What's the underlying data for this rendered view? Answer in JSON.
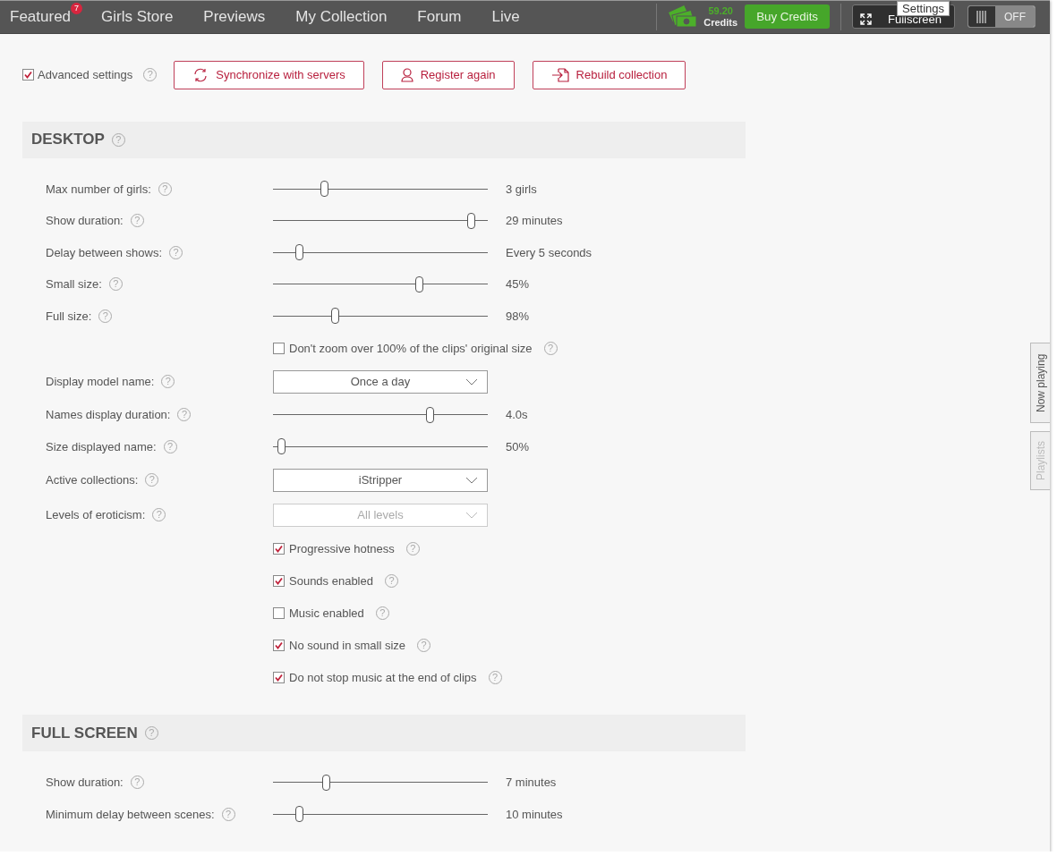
{
  "nav": {
    "items": [
      {
        "label": "Featured",
        "badge": "7",
        "selected": false
      },
      {
        "label": "Girls Store",
        "selected": false
      },
      {
        "label": "Previews",
        "selected": false
      },
      {
        "label": "My Collection",
        "selected": false
      },
      {
        "label": "Forum",
        "selected": false
      },
      {
        "label": "Live",
        "selected": false
      }
    ],
    "credits": {
      "amount": "59.20",
      "label": "Credits"
    },
    "buy_button": "Buy Credits",
    "fullscreen_button": "Fullscreen",
    "tooltip": "Settings",
    "toggle": {
      "label": "OFF",
      "on": false
    }
  },
  "toolbar": {
    "advanced": {
      "label": "Advanced settings",
      "checked": true,
      "help": "?"
    },
    "buttons": [
      {
        "label": "Synchronize with servers",
        "kind": "sync"
      },
      {
        "label": "Register again",
        "kind": "user"
      },
      {
        "label": "Rebuild collection",
        "kind": "import"
      }
    ]
  },
  "sections": [
    {
      "title": "DESKTOP",
      "help": "?",
      "rows": [
        {
          "kind": "slider",
          "label": "Max number of girls:",
          "help": "?",
          "level": 0.23,
          "reading": "3 girls"
        },
        {
          "kind": "slider",
          "label": "Show duration:",
          "help": "?",
          "level": 0.94,
          "reading": "29 minutes"
        },
        {
          "kind": "slider",
          "label": "Delay between shows:",
          "help": "?",
          "level": 0.11,
          "reading": "Every 5 seconds"
        },
        {
          "kind": "slider",
          "label": "Small size:",
          "help": "?",
          "level": 0.69,
          "reading": "45%"
        },
        {
          "kind": "slider",
          "label": "Full size:",
          "help": "?",
          "level": 0.28,
          "reading": "98%"
        },
        {
          "kind": "checkbox",
          "text": "Don't zoom over 100% of the clips' original size",
          "help": "?",
          "checked": false
        },
        {
          "kind": "select",
          "label": "Display model name:",
          "help": "?",
          "value": "Once a day",
          "disabled": false
        },
        {
          "kind": "slider",
          "label": "Names display duration:",
          "help": "?",
          "level": 0.74,
          "reading": "4.0s"
        },
        {
          "kind": "slider",
          "label": "Size displayed name:",
          "help": "?",
          "level": 0.02,
          "reading": "50%"
        },
        {
          "kind": "select",
          "label": "Active collections:",
          "help": "?",
          "value": "iStripper",
          "disabled": false
        },
        {
          "kind": "select",
          "label": "Levels of eroticism:",
          "help": "?",
          "value": "All levels",
          "disabled": true
        },
        {
          "kind": "checkbox",
          "text": "Progressive hotness",
          "help": "?",
          "checked": true
        },
        {
          "kind": "checkbox",
          "text": "Sounds enabled",
          "help": "?",
          "checked": true
        },
        {
          "kind": "checkbox",
          "text": "Music enabled",
          "help": "?",
          "checked": false
        },
        {
          "kind": "checkbox",
          "text": "No sound in small size",
          "help": "?",
          "checked": true
        },
        {
          "kind": "checkbox",
          "text": "Do not stop music at the end of clips",
          "help": "?",
          "checked": true
        }
      ]
    },
    {
      "title": "FULL SCREEN",
      "help": "?",
      "rows": [
        {
          "kind": "slider",
          "label": "Show duration:",
          "help": "?",
          "level": 0.24,
          "reading": "7 minutes"
        },
        {
          "kind": "slider",
          "label": "Minimum delay between scenes:",
          "help": "?",
          "level": 0.11,
          "reading": "10 minutes"
        }
      ]
    }
  ],
  "side_tabs": [
    {
      "label": "Now playing",
      "selected": true
    },
    {
      "label": "Playlists",
      "selected": false
    }
  ]
}
